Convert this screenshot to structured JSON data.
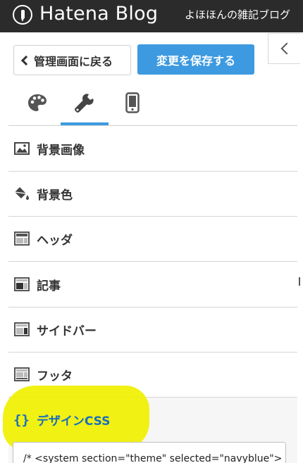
{
  "header": {
    "brand": "Hatena Blog",
    "blog_name": "よほほんの雑記ブログ"
  },
  "toolbar": {
    "back_label": "管理画面に戻る",
    "save_label": "変更を保存する"
  },
  "tabs": [
    {
      "icon": "palette-icon",
      "active": false
    },
    {
      "icon": "wrench-icon",
      "active": true
    },
    {
      "icon": "smartphone-icon",
      "active": false
    }
  ],
  "menu": {
    "items": [
      {
        "label": "背景画像",
        "icon": "image-icon"
      },
      {
        "label": "背景色",
        "icon": "paint-bucket-icon"
      },
      {
        "label": "ヘッダ",
        "icon": "layout-header-icon"
      },
      {
        "label": "記事",
        "icon": "layout-article-icon"
      },
      {
        "label": "サイドバー",
        "icon": "layout-sidebar-icon"
      },
      {
        "label": "フッタ",
        "icon": "layout-footer-icon"
      },
      {
        "label": "デザインCSS",
        "icon": "braces-icon",
        "prefix": "{}",
        "selected": true
      }
    ]
  },
  "css_editor": {
    "value": "/* <system section=\"theme\" selected=\"navyblue\">"
  },
  "colors": {
    "topbar": "#2b2b2b",
    "accent": "#3d9ae0",
    "selected_text": "#1a6fba",
    "highlight": "#f0f000"
  }
}
